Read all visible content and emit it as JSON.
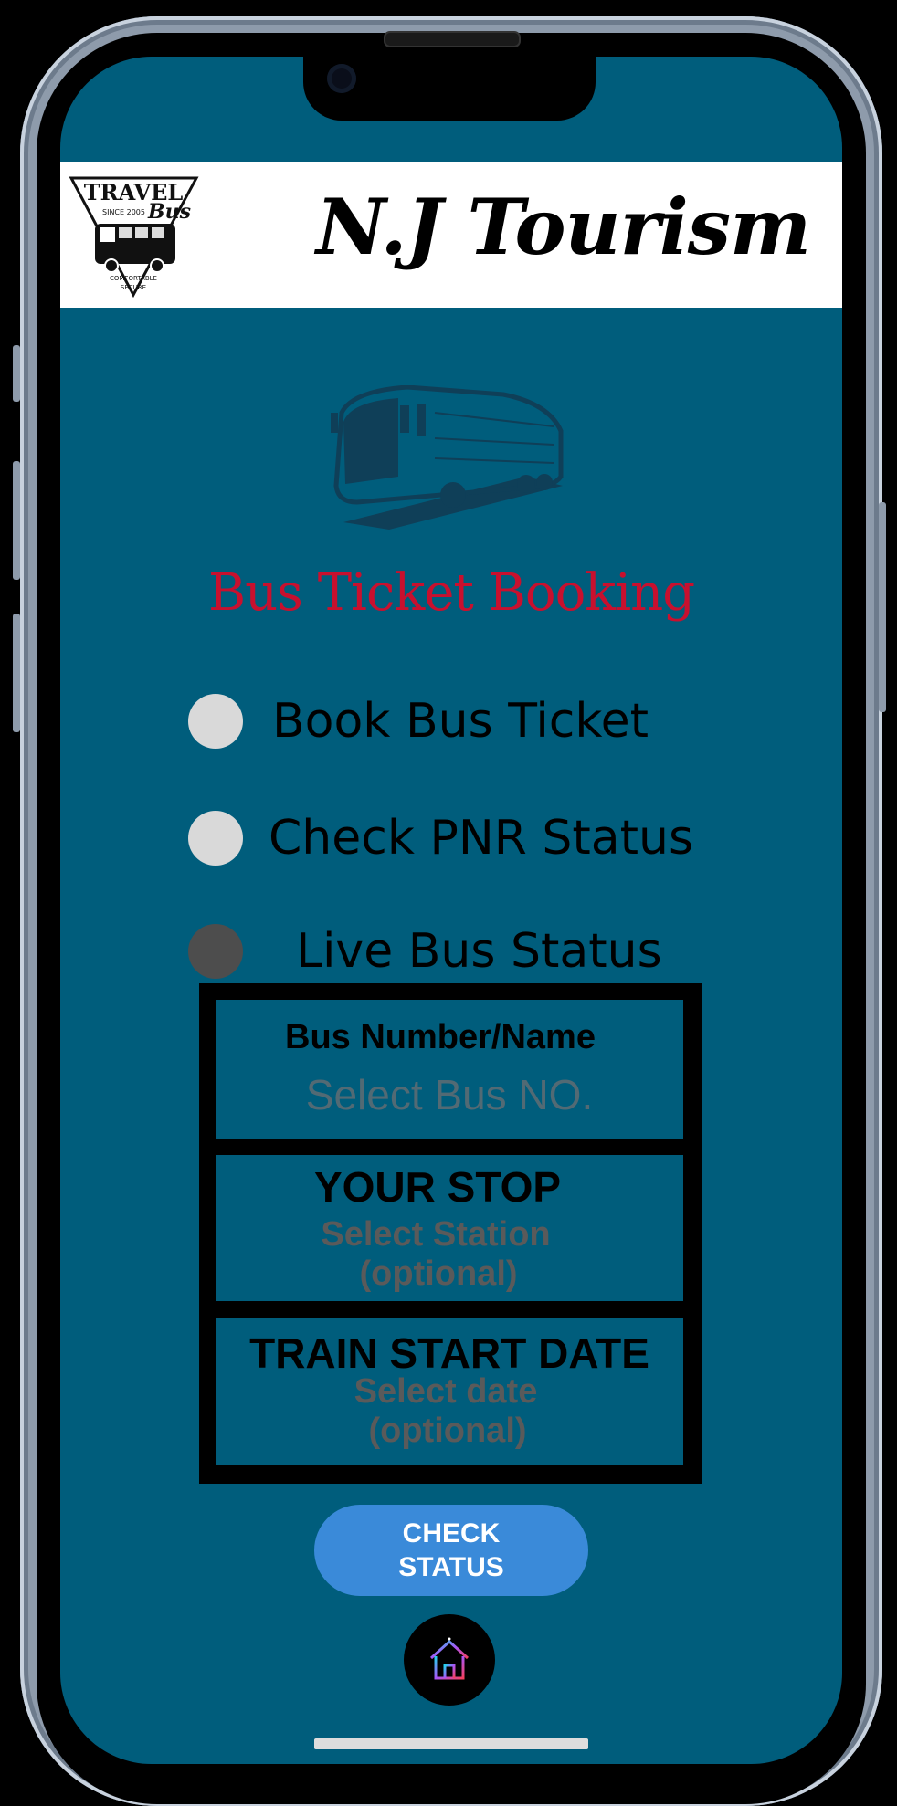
{
  "header": {
    "logo_text": {
      "top": "TRAVEL",
      "script": "Bus",
      "since": "SINCE 2005",
      "bottom1": "COMFORTABLE",
      "bottom2": "SECURE"
    },
    "brand_title": "N.J Tourism"
  },
  "main": {
    "title": "Bus Ticket Booking",
    "hero_icon": "bus-icon",
    "options": [
      {
        "label": "Book Bus Ticket",
        "selected": false
      },
      {
        "label": "Check PNR Status",
        "selected": false
      },
      {
        "label": "Live Bus Status",
        "selected": true
      }
    ]
  },
  "form": {
    "bus": {
      "title": "Bus Number/Name",
      "placeholder": "Select Bus NO."
    },
    "stop": {
      "title": "YOUR STOP",
      "placeholder_line1": "Select Station",
      "placeholder_line2": "(optional)"
    },
    "date": {
      "title": "TRAIN START DATE",
      "placeholder_line1": "Select date",
      "placeholder_line2": "(optional)"
    }
  },
  "actions": {
    "check_line1": "CHECK",
    "check_line2": "STATUS",
    "home_icon": "home-icon"
  },
  "colors": {
    "background": "#005d7c",
    "title_red": "#c8102e",
    "button_blue": "#3a8ad9",
    "radio_default": "#d9d9d9",
    "radio_selected": "#4d4d4d"
  }
}
